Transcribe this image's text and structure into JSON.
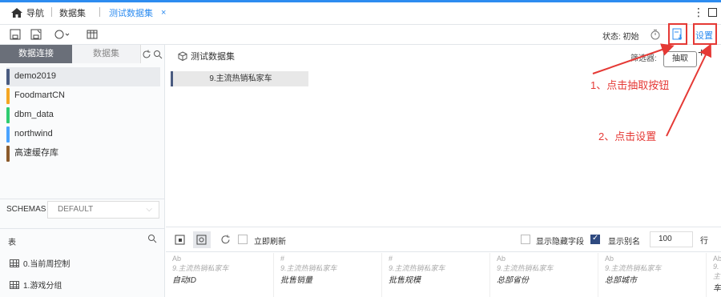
{
  "topbar": {
    "home_label": "导航",
    "tab1": "数据集",
    "tab2": "测试数据集",
    "close": "×",
    "more": "⋮"
  },
  "toolbar": {
    "status": "状态: 初始",
    "settings": "设置"
  },
  "left": {
    "tab_connections": "数据连接",
    "tab_datasets": "数据集",
    "connections": [
      {
        "name": "demo2019",
        "color": "#4a5b80"
      },
      {
        "name": "FoodmartCN",
        "color": "#f5a623"
      },
      {
        "name": "dbm_data",
        "color": "#2ecc71"
      },
      {
        "name": "northwind",
        "color": "#4aa3ff"
      },
      {
        "name": "高速缓存库",
        "color": "#8b5a2b"
      }
    ],
    "schemas_label": "SCHEMAS",
    "schemas_value": "DEFAULT",
    "tables_label": "表",
    "tables": [
      "0.当前周控制",
      "1.游戏分组"
    ]
  },
  "main": {
    "dataset_title": "测试数据集",
    "chip": "9.主流热销私家车",
    "filter_label": "筛选器:",
    "tooltip": "抽取",
    "plus": "+"
  },
  "annotations": {
    "step1": "1、点击抽取按钮",
    "step2": "2、点击设置"
  },
  "bottom": {
    "refresh_label": "立即刷新",
    "show_hidden": "显示隐藏字段",
    "show_alias": "显示别名",
    "rows_value": "100",
    "rows_unit": "行",
    "columns": [
      {
        "type": "Ab",
        "src": "9.主流热销私家车",
        "name": "自动ID"
      },
      {
        "type": "#",
        "src": "9.主流热销私家车",
        "name": "批售销量"
      },
      {
        "type": "#",
        "src": "9.主流热销私家车",
        "name": "批售规模"
      },
      {
        "type": "Ab",
        "src": "9.主流热销私家车",
        "name": "总部省份"
      },
      {
        "type": "Ab",
        "src": "9.主流热销私家车",
        "name": "总部城市"
      },
      {
        "type": "Ab",
        "src": "9.主",
        "name": "车"
      }
    ]
  }
}
